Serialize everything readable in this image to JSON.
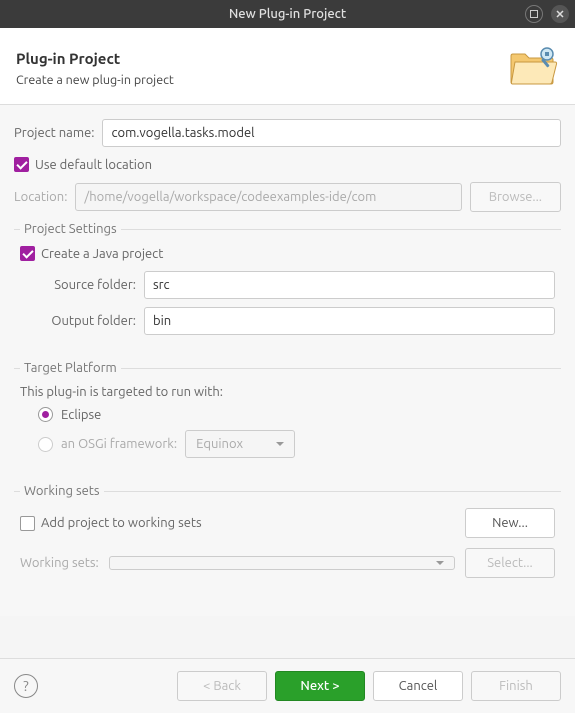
{
  "titlebar": {
    "title": "New Plug-in Project"
  },
  "header": {
    "title": "Plug-in Project",
    "subtitle": "Create a new plug-in project"
  },
  "projectName": {
    "label": "Project name:",
    "value": "com.vogella.tasks.model"
  },
  "defaultLocation": {
    "label": "Use default location",
    "checked": true
  },
  "location": {
    "label": "Location:",
    "value": "/home/vogella/workspace/codeexamples-ide/com",
    "browse": "Browse..."
  },
  "projectSettings": {
    "legend": "Project Settings",
    "createJava": {
      "label": "Create a Java project",
      "checked": true
    },
    "sourceFolder": {
      "label": "Source folder:",
      "value": "src"
    },
    "outputFolder": {
      "label": "Output folder:",
      "value": "bin"
    }
  },
  "targetPlatform": {
    "legend": "Target Platform",
    "intro": "This plug-in is targeted to run with:",
    "eclipse": "Eclipse",
    "osgi": "an OSGi framework:",
    "osgiSelect": "Equinox"
  },
  "workingSets": {
    "legend": "Working sets",
    "addLabel": "Add project to working sets",
    "newBtn": "New...",
    "setsLabel": "Working sets:",
    "selectBtn": "Select..."
  },
  "footer": {
    "back": "< Back",
    "next": "Next >",
    "cancel": "Cancel",
    "finish": "Finish"
  }
}
